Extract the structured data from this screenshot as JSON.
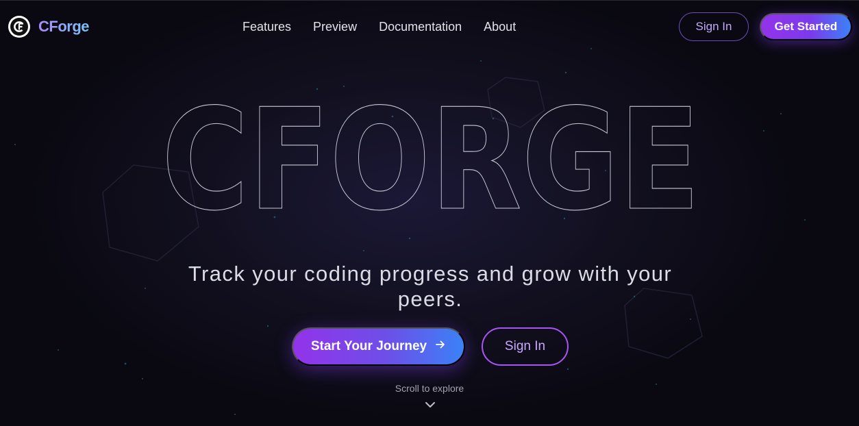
{
  "brand": {
    "name": "CForge",
    "logo_icon": "cforge-logo-icon"
  },
  "nav": {
    "links": [
      {
        "label": "Features"
      },
      {
        "label": "Preview"
      },
      {
        "label": "Documentation"
      },
      {
        "label": "About"
      }
    ],
    "sign_in_label": "Sign In",
    "get_started_label": "Get Started"
  },
  "hero": {
    "title": "CFORGE",
    "tagline": "Track your coding progress and grow with your peers.",
    "primary_cta": "Start Your Journey",
    "primary_cta_icon": "arrow-right-icon",
    "secondary_cta": "Sign In",
    "scroll_hint": "Scroll to explore",
    "scroll_icon": "chevron-down-icon"
  },
  "colors": {
    "background": "#0b0a14",
    "accent_purple": "#9333ea",
    "accent_blue": "#3b82f6",
    "outline_button": "#a855f7"
  }
}
